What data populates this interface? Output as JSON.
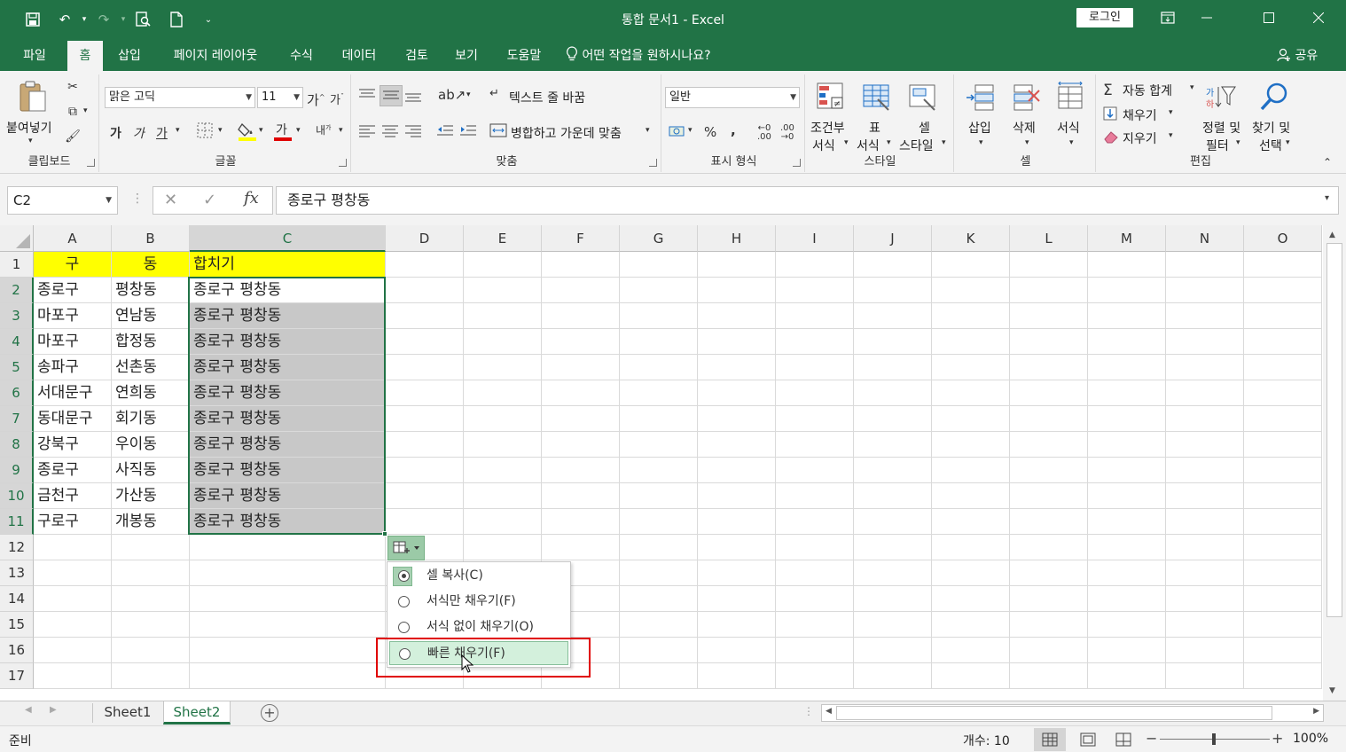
{
  "window": {
    "title": "통합 문서1  -  Excel",
    "login_label": "로그인"
  },
  "ribbon_tabs": [
    "파일",
    "홈",
    "삽입",
    "페이지 레이아웃",
    "수식",
    "데이터",
    "검토",
    "보기",
    "도움말"
  ],
  "tellme": "어떤 작업을 원하시나요?",
  "share": "공유",
  "ribbon": {
    "clipboard": {
      "paste": "붙여넣기",
      "label": "클립보드"
    },
    "font": {
      "name": "맑은 고딕",
      "size": "11",
      "bold": "가",
      "italic": "가",
      "underline": "가",
      "grow": "가",
      "shrink": "가",
      "label": "글꼴"
    },
    "align": {
      "wrap": "텍스트 줄 바꿈",
      "merge": "병합하고 가운데 맞춤",
      "label": "맞춤"
    },
    "number": {
      "format": "일반",
      "label": "표시 형식"
    },
    "styles": {
      "cond1": "조건부",
      "cond2": "서식",
      "table1": "표",
      "table2": "서식",
      "cell1": "셀",
      "cell2": "스타일",
      "label": "스타일"
    },
    "cells": {
      "insert": "삽입",
      "delete": "삭제",
      "format": "서식",
      "label": "셀"
    },
    "edit": {
      "autosum": "자동 합계",
      "fill": "채우기",
      "clear": "지우기",
      "sort1": "정렬 및",
      "sort2": "필터",
      "find1": "찾기 및",
      "find2": "선택",
      "label": "편집"
    }
  },
  "formula_bar": {
    "name_box": "C2",
    "formula": "종로구 평창동"
  },
  "columns": [
    "A",
    "B",
    "C",
    "D",
    "E",
    "F",
    "G",
    "H",
    "I",
    "J",
    "K",
    "L",
    "M",
    "N",
    "O"
  ],
  "rows": [
    "1",
    "2",
    "3",
    "4",
    "5",
    "6",
    "7",
    "8",
    "9",
    "10",
    "11",
    "12",
    "13",
    "14",
    "15",
    "16",
    "17"
  ],
  "cells": {
    "header": [
      "구",
      "동",
      "합치기"
    ],
    "data": [
      [
        "종로구",
        "평창동",
        "종로구 평창동"
      ],
      [
        "마포구",
        "연남동",
        "종로구 평창동"
      ],
      [
        "마포구",
        "합정동",
        "종로구 평창동"
      ],
      [
        "송파구",
        "선촌동",
        "종로구 평창동"
      ],
      [
        "서대문구",
        "연희동",
        "종로구 평창동"
      ],
      [
        "동대문구",
        "회기동",
        "종로구 평창동"
      ],
      [
        "강북구",
        "우이동",
        "종로구 평창동"
      ],
      [
        "종로구",
        "사직동",
        "종로구 평창동"
      ],
      [
        "금천구",
        "가산동",
        "종로구 평창동"
      ],
      [
        "구로구",
        "개봉동",
        "종로구 평창동"
      ]
    ]
  },
  "autofill_menu": {
    "items": [
      {
        "label": "셀 복사(C)",
        "selected": true
      },
      {
        "label": "서식만 채우기(F)",
        "selected": false
      },
      {
        "label": "서식 없이 채우기(O)",
        "selected": false
      },
      {
        "label": "빠른 채우기(F)",
        "selected": false,
        "highlighted": true
      }
    ]
  },
  "sheets": [
    "Sheet1",
    "Sheet2"
  ],
  "active_sheet": "Sheet2",
  "status": {
    "ready": "준비",
    "count": "개수: 10",
    "zoom": "100%"
  },
  "colors": {
    "accent": "#217346",
    "header_fill": "#ffff00",
    "fill_sel": "#c8c8c8",
    "highlight_box": "#e00000"
  }
}
